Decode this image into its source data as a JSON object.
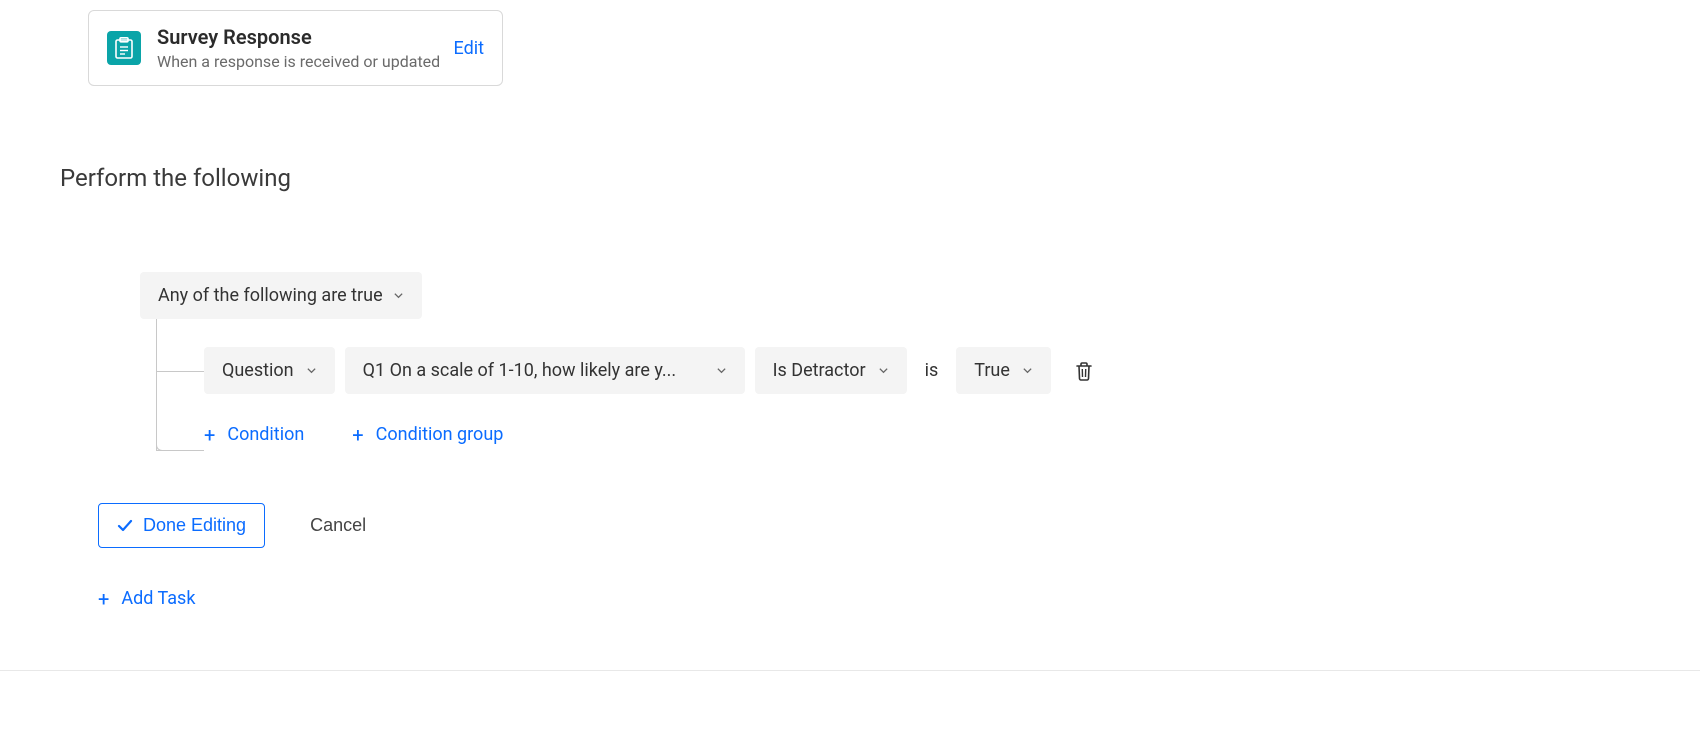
{
  "trigger": {
    "title": "Survey Response",
    "subtitle": "When a response is received or updated",
    "edit_label": "Edit"
  },
  "section": {
    "title": "Perform the following"
  },
  "logic": {
    "label": "Any of the following are true"
  },
  "condition": {
    "field_type": "Question",
    "question_label": "Q1 On a scale of 1-10, how likely are y...",
    "operator": "Is Detractor",
    "connector": "is",
    "value": "True"
  },
  "actions": {
    "add_condition": "Condition",
    "add_condition_group": "Condition group",
    "done_editing": "Done Editing",
    "cancel": "Cancel",
    "add_task": "Add Task"
  }
}
